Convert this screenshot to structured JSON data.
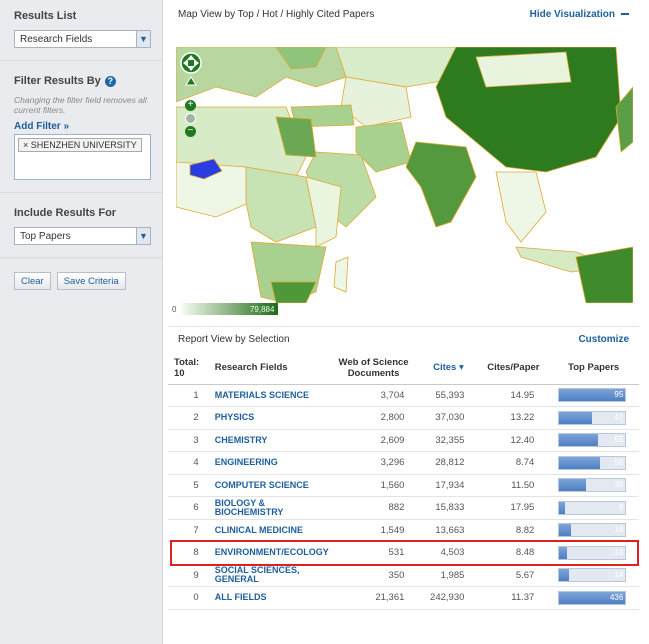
{
  "sidebar": {
    "results_list_title": "Results List",
    "results_list_value": "Research Fields",
    "filter_title": "Filter Results By",
    "filter_hint": "Changing the filter field removes all current filters.",
    "add_filter": "Add Filter »",
    "filter_chip": "× SHENZHEN UNIVERSITY",
    "include_title": "Include Results For",
    "include_value": "Top Papers",
    "clear_label": "Clear",
    "save_label": "Save Criteria"
  },
  "map_panel": {
    "title": "Map View by Top / Hot / Highly Cited Papers",
    "hide_label": "Hide Visualization",
    "legend_min": "0",
    "legend_max": "79,884"
  },
  "report": {
    "title": "Report View by Selection",
    "customize_label": "Customize",
    "headers": {
      "total": "Total:",
      "total_count": "10",
      "field": "Research Fields",
      "wos": "Web of Science Documents",
      "cites": "Cites ▾",
      "cites_per_paper": "Cites/Paper",
      "top_papers": "Top Papers"
    },
    "rows": [
      {
        "rank": "1",
        "field": "MATERIALS SCIENCE",
        "wos": "3,704",
        "cites": "55,393",
        "cpp": "14.95",
        "top": "95",
        "frac": 1.0
      },
      {
        "rank": "2",
        "field": "PHYSICS",
        "wos": "2,800",
        "cites": "37,030",
        "cpp": "13.22",
        "top": "47",
        "frac": 0.49
      },
      {
        "rank": "3",
        "field": "CHEMISTRY",
        "wos": "2,609",
        "cites": "32,355",
        "cpp": "12.40",
        "top": "55",
        "frac": 0.58
      },
      {
        "rank": "4",
        "field": "ENGINEERING",
        "wos": "3,296",
        "cites": "28,812",
        "cpp": "8.74",
        "top": "58",
        "frac": 0.61
      },
      {
        "rank": "5",
        "field": "COMPUTER SCIENCE",
        "wos": "1,560",
        "cites": "17,934",
        "cpp": "11.50",
        "top": "39",
        "frac": 0.41
      },
      {
        "rank": "6",
        "field": "BIOLOGY & BIOCHEMISTRY",
        "wos": "882",
        "cites": "15,833",
        "cpp": "17.95",
        "top": "8",
        "frac": 0.08
      },
      {
        "rank": "7",
        "field": "CLINICAL MEDICINE",
        "wos": "1,549",
        "cites": "13,663",
        "cpp": "8.82",
        "top": "16",
        "frac": 0.17
      },
      {
        "rank": "8",
        "field": "ENVIRONMENT/ECOLOGY",
        "wos": "531",
        "cites": "4,503",
        "cpp": "8.48",
        "top": "10",
        "frac": 0.11
      },
      {
        "rank": "9",
        "field": "SOCIAL SCIENCES, GENERAL",
        "wos": "350",
        "cites": "1,985",
        "cpp": "5.67",
        "top": "14",
        "frac": 0.15
      },
      {
        "rank": "0",
        "field": "ALL FIELDS",
        "wos": "21,361",
        "cites": "242,930",
        "cpp": "11.37",
        "top": "436",
        "frac": 1.0
      }
    ]
  },
  "colors": {
    "link": "#1d5f9c",
    "highlight": "#e02020",
    "map_dark": "#2d7a1f",
    "map_light": "#eef6e6",
    "burkina": "#2a3de0"
  }
}
